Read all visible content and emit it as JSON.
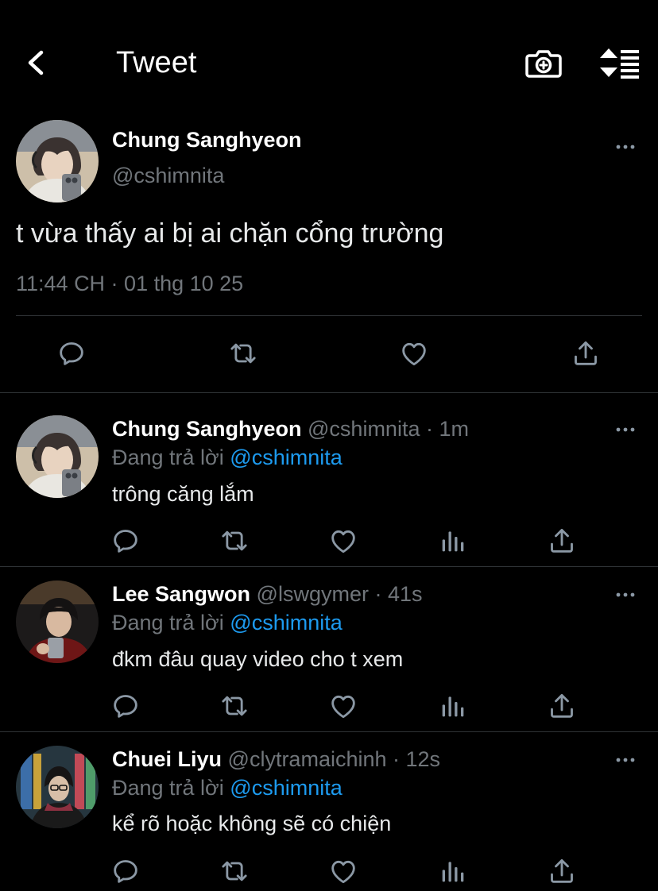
{
  "header": {
    "title": "Tweet",
    "back_icon": "chevron-left-icon",
    "camera_icon": "camera-plus-icon",
    "sort_icon": "sort-icon"
  },
  "main_tweet": {
    "author_name": "Chung Sanghyeon",
    "author_handle": "@cshimnita",
    "text": "t vừa thấy ai bị ai chặn cổng trường",
    "timestamp": "11:44 CH · 01 thg 10 25",
    "actions": [
      "reply-icon",
      "retweet-icon",
      "like-icon",
      "share-icon"
    ]
  },
  "replies": [
    {
      "author_name": "Chung Sanghyeon",
      "author_handle": "@cshimnita",
      "time": "· 1m",
      "replying_prefix": "Đang trả lời",
      "replying_to": "@cshimnita",
      "text": "trông căng lắm"
    },
    {
      "author_name": "Lee Sangwon",
      "author_handle": "@lswgymer",
      "time": "· 41s",
      "replying_prefix": "Đang trả lời",
      "replying_to": "@cshimnita",
      "text": "đkm đâu quay video cho t xem"
    },
    {
      "author_name": "Chuei Liyu",
      "author_handle": "@clytramaichinh",
      "time": "· 12s",
      "replying_prefix": "Đang trả lời",
      "replying_to": "@cshimnita",
      "text": "kể rõ hoặc không sẽ có chiện"
    }
  ],
  "reply_actions": [
    "reply-icon",
    "retweet-icon",
    "like-icon",
    "views-icon",
    "share-icon"
  ],
  "colors": {
    "background": "#000000",
    "text": "#e7e9ea",
    "muted": "#71767b",
    "accent": "#1d9bf0",
    "divider": "#2f3336"
  }
}
